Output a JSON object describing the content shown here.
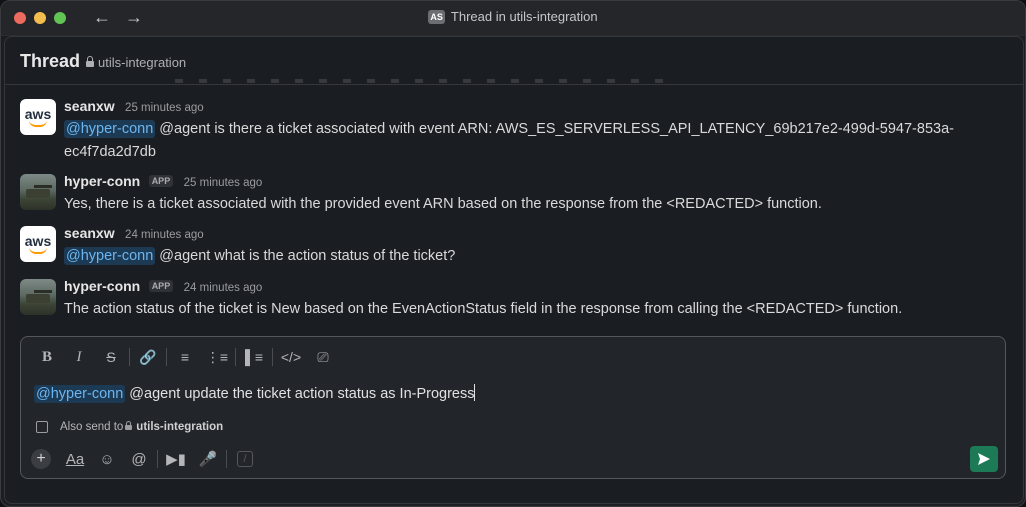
{
  "window": {
    "title": "Thread in utils-integration",
    "workspace_badge": "AS"
  },
  "header": {
    "title": "Thread",
    "channel": "utils-integration"
  },
  "messages": [
    {
      "author": "seanxw",
      "time": "25 minutes ago",
      "mention": "@hyper-conn",
      "text": " @agent is there a ticket associated with event ARN: AWS_ES_SERVERLESS_API_LATENCY_69b217e2-499d-5947-853a-ec4f7da2d7db"
    },
    {
      "author": "hyper-conn",
      "badge": "APP",
      "time": "25 minutes ago",
      "text": "Yes, there is a ticket associated with the provided event ARN based on the response from the <REDACTED> function."
    },
    {
      "author": "seanxw",
      "time": "24 minutes ago",
      "mention": "@hyper-conn",
      "text": " @agent what is the action status of the ticket?"
    },
    {
      "author": "hyper-conn",
      "badge": "APP",
      "time": "24 minutes ago",
      "text": "The action status of the ticket is New based on the EvenActionStatus field in the response from calling the <REDACTED> function."
    }
  ],
  "composer": {
    "mention": "@hyper-conn",
    "text": " @agent update the ticket action status as In-Progress",
    "also_send_label": "Also send to",
    "also_send_channel": "utils-integration"
  },
  "icons": {
    "avatar_aws": "aws-logo",
    "avatar_app": "tank-photo"
  }
}
